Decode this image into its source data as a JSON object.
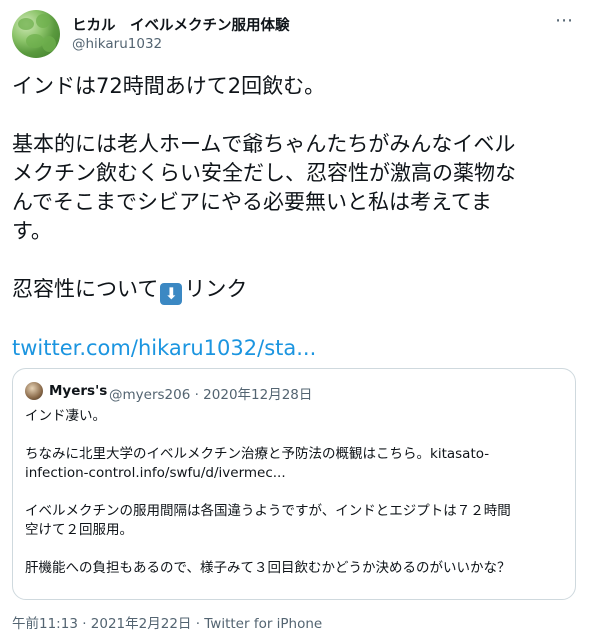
{
  "tweet": {
    "author_name": "ヒカル　イベルメクチン服用体験",
    "author_handle": "@hikaru1032",
    "more_icon": "more-dots-icon",
    "line1": "インドは72時間あけて2回飲む。",
    "para2_line1": "基本的には老人ホームで爺ちゃんたちがみんなイベル",
    "para2_line2": "メクチン飲むくらい安全だし、忍容性が激高の薬物な",
    "para2_line3": "んでそこまでシビアにやる必要無いと私は考えてま",
    "para2_line4": "す。",
    "para3_prefix": "忍容性について",
    "para3_emoji": "⬇",
    "para3_suffix": "リンク",
    "link_text": "twitter.com/hikaru1032/sta...",
    "timestamp": "午前11:13 · 2021年2月22日 · Twitter for iPhone"
  },
  "quoted": {
    "author_name": "Myers's",
    "author_handle": "@myers206 · 2020年12月28日",
    "line1": "インド凄い。",
    "line2": "ちなみに北里大学のイベルメクチン治療と予防法の概観はこちら。kitasato-",
    "line3": "infection-control.info/swfu/d/ivermec...",
    "line4": "イベルメクチンの服用間隔は各国違うようですが、インドとエジプトは７２時間",
    "line5": "空けて２回服用。",
    "line6": "肝機能への負担もあるので、様子みて３回目飲むかどうか決めるのがいいかな？"
  },
  "colors": {
    "text": "#0f1419",
    "secondary": "#536471",
    "link": "#1b95e0",
    "border": "#cfd9de"
  }
}
